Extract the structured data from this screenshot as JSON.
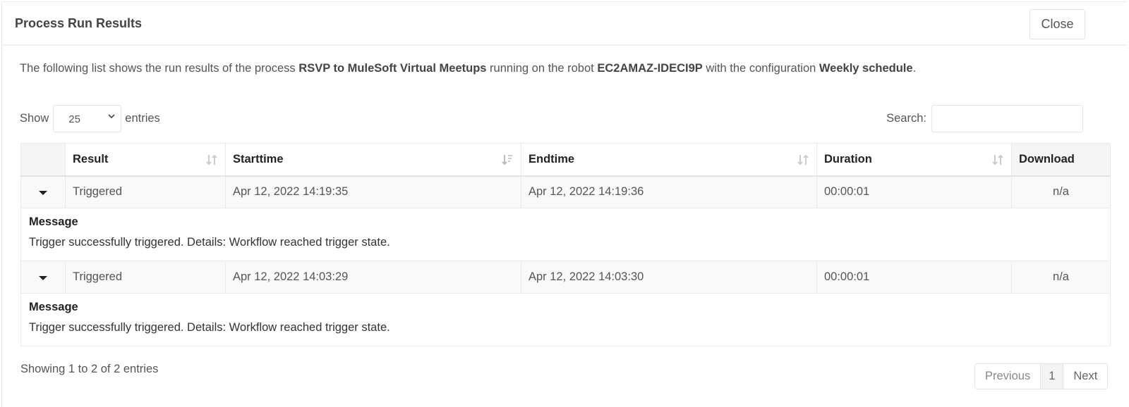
{
  "modal": {
    "title": "Process Run Results",
    "close_label": "Close"
  },
  "intro": {
    "prefix": "The following list shows the run results of the process ",
    "process_name": "RSVP to MuleSoft Virtual Meetups",
    "mid1": " running on the robot ",
    "robot_name": "EC2AMAZ-IDECI9P",
    "mid2": " with the configuration ",
    "configuration": "Weekly schedule",
    "suffix": "."
  },
  "length": {
    "show_label": "Show",
    "value": "25",
    "entries_label": "entries"
  },
  "search": {
    "label": "Search:",
    "value": "",
    "placeholder": ""
  },
  "table": {
    "columns": [
      "",
      "Result",
      "Starttime",
      "Endtime",
      "Duration",
      "Download"
    ],
    "rows": [
      {
        "result": "Triggered",
        "starttime": "Apr 12, 2022 14:19:35",
        "endtime": "Apr 12, 2022 14:19:36",
        "duration": "00:00:01",
        "download": "n/a",
        "message_title": "Message",
        "message": "Trigger successfully triggered. Details: Workflow reached trigger state."
      },
      {
        "result": "Triggered",
        "starttime": "Apr 12, 2022 14:03:29",
        "endtime": "Apr 12, 2022 14:03:30",
        "duration": "00:00:01",
        "download": "n/a",
        "message_title": "Message",
        "message": "Trigger successfully triggered. Details: Workflow reached trigger state."
      }
    ]
  },
  "footer": {
    "info": "Showing 1 to 2 of 2 entries",
    "previous": "Previous",
    "page": "1",
    "next": "Next"
  },
  "colors": {
    "result_link": "#3fa47e"
  }
}
